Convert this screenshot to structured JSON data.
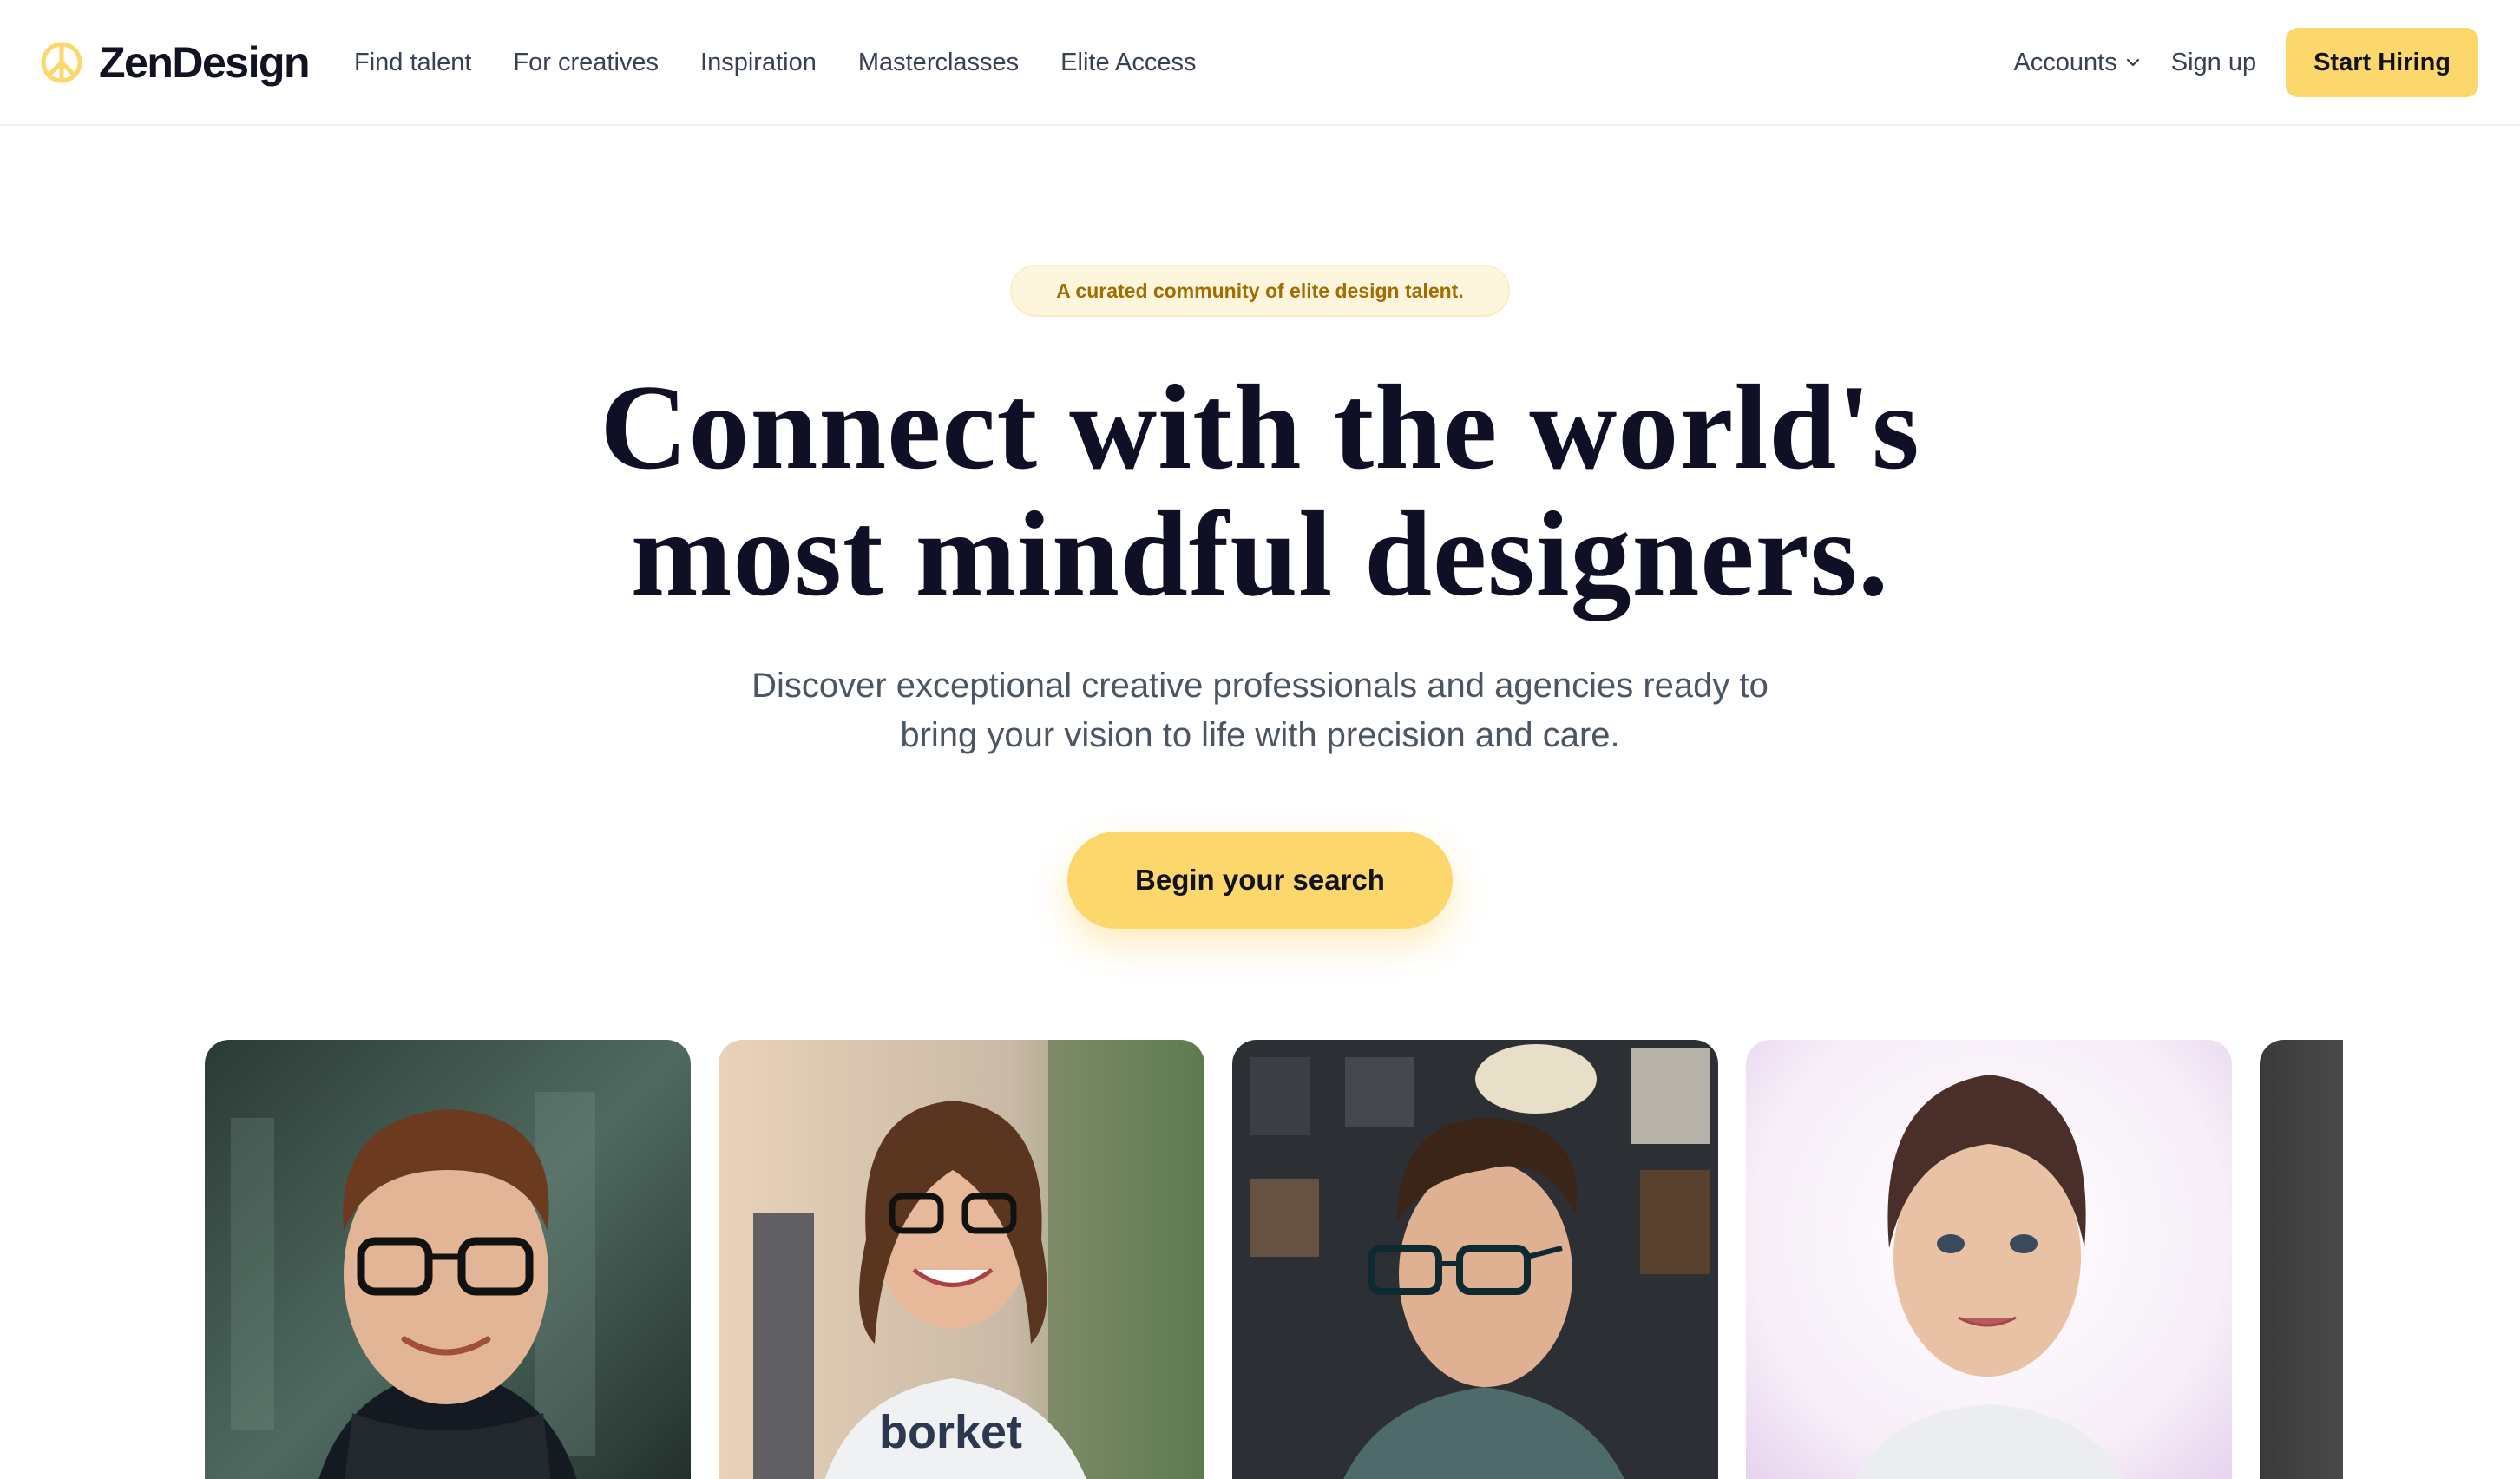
{
  "brand": {
    "name": "ZenDesign",
    "logo_icon": "peace-sign-icon",
    "accent": "#fcd76b"
  },
  "nav": {
    "links": [
      "Find talent",
      "For creatives",
      "Inspiration",
      "Masterclasses",
      "Elite Access"
    ],
    "accounts_label": "Accounts",
    "signup_label": "Sign up",
    "start_hiring_label": "Start Hiring"
  },
  "hero": {
    "badge": "A curated community of elite design talent.",
    "headline_line1": "Connect with the world's",
    "headline_line2": "most mindful designers.",
    "subtitle_line1": "Discover exceptional creative professionals and agencies ready to",
    "subtitle_line2": "bring your vision to life with precision and care.",
    "cta_label": "Begin your search"
  },
  "designers": [
    {
      "photo": "man with glasses and dark scarf"
    },
    {
      "photo": "smiling woman with glasses in white tee"
    },
    {
      "photo": "young man with glasses in studio"
    },
    {
      "photo": "woman with hair tied back on light background"
    }
  ]
}
